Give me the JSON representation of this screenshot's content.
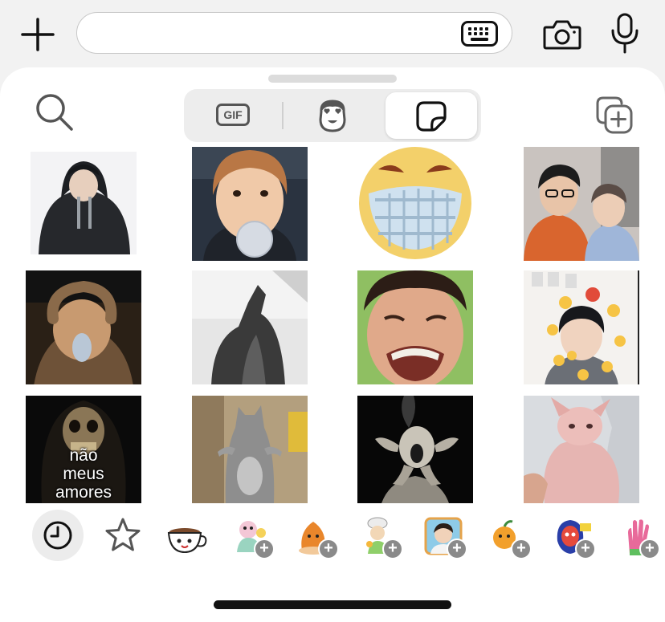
{
  "composer": {
    "placeholder": "",
    "icons": [
      "plus-icon",
      "keyboard-icon",
      "camera-icon",
      "microphone-icon"
    ]
  },
  "tabs": [
    {
      "name": "gif",
      "label": "GIF"
    },
    {
      "name": "emoji",
      "icon": "heart-eyes-face-icon"
    },
    {
      "name": "stickers",
      "icon": "sticker-icon",
      "selected": true
    }
  ],
  "stickers": [
    {
      "name": "person-hoodie-sticker"
    },
    {
      "name": "bubblegum-boy-sticker"
    },
    {
      "name": "pixel-grin-emoji-sticker"
    },
    {
      "name": "two-friends-laughing-sticker"
    },
    {
      "name": "blurry-monkey-sticker"
    },
    {
      "name": "howling-cat-sticker"
    },
    {
      "name": "crying-man-sticker"
    },
    {
      "name": "boy-emoji-crown-sticker"
    },
    {
      "name": "skull-reaper-sticker",
      "caption": "não\nmeus\namores"
    },
    {
      "name": "standing-cat-sticker"
    },
    {
      "name": "screaming-figure-sticker"
    },
    {
      "name": "hairless-cat-sticker"
    }
  ],
  "tray": [
    {
      "name": "recent-icon",
      "selected": true
    },
    {
      "name": "favorites-star-icon"
    },
    {
      "name": "coffee-cup-pack"
    },
    {
      "name": "pastel-character-pack",
      "addable": true
    },
    {
      "name": "orange-blob-pack",
      "addable": true
    },
    {
      "name": "chef-character-pack",
      "addable": true
    },
    {
      "name": "photo-portrait-pack",
      "addable": true
    },
    {
      "name": "orange-fruit-pack",
      "addable": true
    },
    {
      "name": "red-hair-girl-pack",
      "addable": true
    },
    {
      "name": "pink-hand-pack",
      "addable": true
    }
  ]
}
